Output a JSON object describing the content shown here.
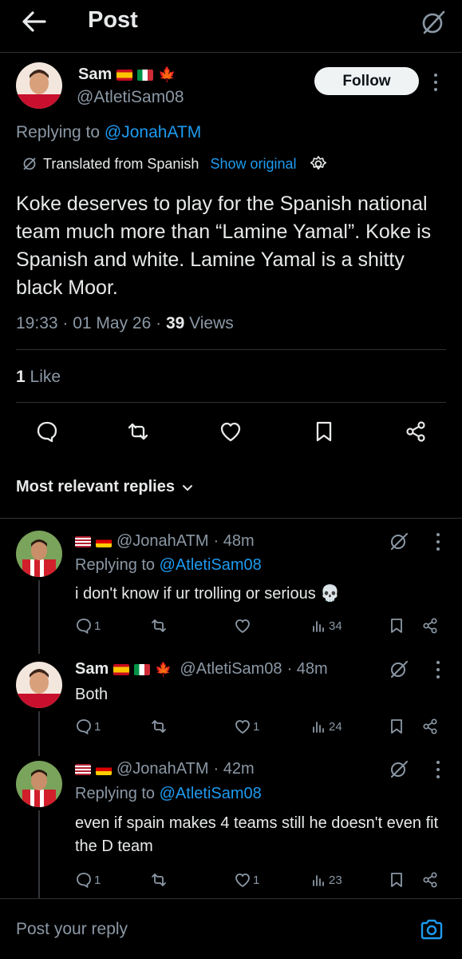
{
  "header": {
    "title": "Post"
  },
  "post": {
    "author_name": "Sam",
    "author_handle": "@AtletiSam08",
    "follow_label": "Follow",
    "replying_prefix": "Replying to ",
    "replying_handle": "@JonahATM",
    "translated_label": "Translated from Spanish",
    "show_original_label": "Show original",
    "text": "Koke deserves to play for the Spanish national team much more than “Lamine Yamal”. Koke is Spanish and white. Lamine Yamal is a shitty black Moor.",
    "time": "19:33 · 01 May 26 · ",
    "views_count": "39",
    "views_label": " Views",
    "likes_count": "1",
    "likes_label": " Like"
  },
  "replies_header": {
    "label": "Most relevant replies"
  },
  "replies": [
    {
      "name": "",
      "handle": "@JonahATM",
      "time": "· 48m",
      "replying_prefix": "Replying to ",
      "replying_handle": "@AtletiSam08",
      "text": "i don't know if ur trolling or serious 💀",
      "reply_count": "1",
      "like_count": "",
      "view_count": "34"
    },
    {
      "name": "Sam",
      "handle": "@AtletiSam08",
      "time": "· 48m",
      "text": "Both",
      "reply_count": "1",
      "like_count": "1",
      "view_count": "24"
    },
    {
      "name": "",
      "handle": "@JonahATM",
      "time": "· 42m",
      "replying_prefix": "Replying to ",
      "replying_handle": "@AtletiSam08",
      "text": "even if spain makes 4 teams still he doesn't even fit the D team",
      "reply_count": "1",
      "like_count": "1",
      "view_count": "23"
    }
  ],
  "composer": {
    "placeholder": "Post your reply"
  },
  "colors": {
    "accent": "#1d9bf0",
    "background": "#000000",
    "muted": "#8b98a5"
  },
  "icons": [
    "back-arrow-icon",
    "grok-icon",
    "more-vertical-icon",
    "globe-icon",
    "gear-icon",
    "reply-icon",
    "repost-icon",
    "like-icon",
    "bookmark-icon",
    "share-icon",
    "views-icon",
    "chevron-down-icon",
    "camera-icon"
  ]
}
